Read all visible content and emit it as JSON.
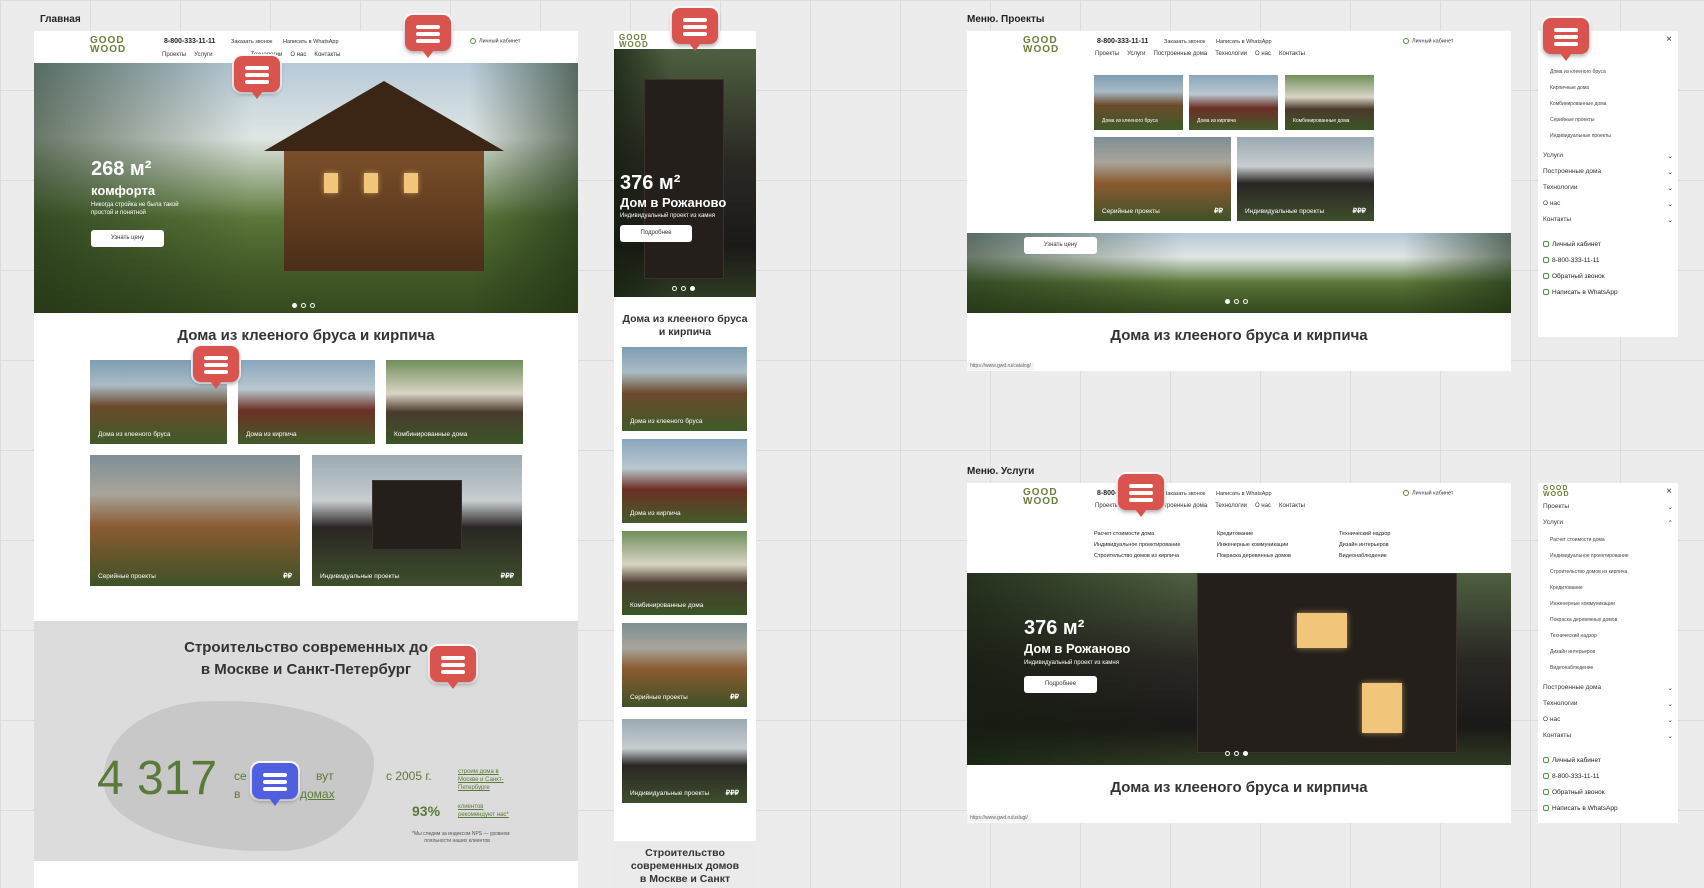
{
  "labels": {
    "main": "Главная",
    "menu_projects": "Меню. Проекты",
    "menu_services": "Меню. Услуги"
  },
  "header": {
    "phone": "8-800-333-11-11",
    "callback": "Заказать звонок",
    "whatsapp": "Написать в WhatsApp",
    "account": "Личный кабинет",
    "nav": [
      "Проекты",
      "Услуги",
      "Построенные дома",
      "Технологии",
      "О нас",
      "Контакты"
    ],
    "nav_main": [
      "Проекты",
      "Услуги",
      "Технологии",
      "О нас",
      "Контакты"
    ]
  },
  "hero_main": {
    "area": "268 м²",
    "title": "комфорта",
    "subtitle_1": "Никогда стройка не была такой",
    "subtitle_2": "простой и понятной",
    "button": "Узнать цену"
  },
  "hero_rozh": {
    "area": "376 м²",
    "title": "Дом в Рожаново",
    "subtitle": "Индивидуальный проект из камня",
    "button": "Подробнее"
  },
  "section_houses": {
    "title": "Дома из клееного бруса и кирпича",
    "title_mobile_1": "Дома из клееного бруса",
    "title_mobile_2": "и кирпича",
    "tiles": [
      {
        "label": "Дома из клееного бруса",
        "rub": ""
      },
      {
        "label": "Дома из кирпича",
        "rub": ""
      },
      {
        "label": "Комбинированные дома",
        "rub": ""
      },
      {
        "label": "Серийные проекты",
        "rub": "₽₽"
      },
      {
        "label": "Индивидуальные проекты",
        "rub": "₽₽₽"
      }
    ]
  },
  "section_build": {
    "title_1": "Строительство современных до",
    "title_2": "в Москве и Санкт-Петербург",
    "mobile_1": "Строительство",
    "mobile_2": "современных домов",
    "mobile_3": "в Москве и Санкт",
    "big_number": "4 317",
    "families_1": "се",
    "families_2": "вут",
    "families_3": "в",
    "families_4": "домах",
    "since": "с 2005 г.",
    "since_link_1": "строим дома в",
    "since_link_2": "Москве и Санкт-",
    "since_link_3": "Петербурге",
    "nps_value": "93%",
    "nps_link_1": "клиентов",
    "nps_link_2": "рекомендуют нас*",
    "footnote_1": "*Мы следим за индексом NPS — уровнем",
    "footnote_2": "лояльности наших клиентов"
  },
  "menu_projects": {
    "close": "×",
    "sub": [
      "Дома из клееного бруса",
      "Кирпичные дома",
      "Комбинированные дома",
      "Серийные проекты",
      "Индивидуальные проекты"
    ],
    "items": [
      "Услуги",
      "Построенные дома",
      "Технологии",
      "О нас",
      "Контакты"
    ],
    "contacts": [
      "Личный кабинет",
      "8-800-333-11-11",
      "Обратный звонок",
      "Написать в WhatsApp"
    ],
    "url": "https://www.gwd.ru/catalog/"
  },
  "menu_services": {
    "close": "×",
    "top": "Проекты",
    "open": "Услуги",
    "sub": [
      "Расчет стоимости дома",
      "Индивидуальное проектирование",
      "Строительство домов из кирпича",
      "Кредитование",
      "Инженерные коммуникации",
      "Покраска деревянных домов",
      "Технический надзор",
      "Дизайн интерьеров",
      "Видеонаблюдение"
    ],
    "items": [
      "Построенные дома",
      "Технологии",
      "О нас",
      "Контакты"
    ],
    "contacts": [
      "Личный кабинет",
      "8-800-333-11-11",
      "Обратный звонок",
      "Написать в WhatsApp"
    ],
    "dropdown_col1": [
      "Расчет стоимости дома",
      "Индивидуальное проектирование",
      "Строительство домов из кирпича"
    ],
    "dropdown_col2": [
      "Кредитование",
      "Инженерные коммуникации",
      "Покраска деревянных домов"
    ],
    "dropdown_col3": [
      "Технический надзор",
      "Дизайн интерьеров",
      "Видеонаблюдение"
    ],
    "url": "https://www.gwd.ru/uslugi/"
  },
  "logo": {
    "line1": "GOOD",
    "line2": "WOOD"
  },
  "colors": {
    "accent": "#5a7a3a",
    "pin": "#d9534f",
    "pin_active": "#4f5fe0"
  }
}
